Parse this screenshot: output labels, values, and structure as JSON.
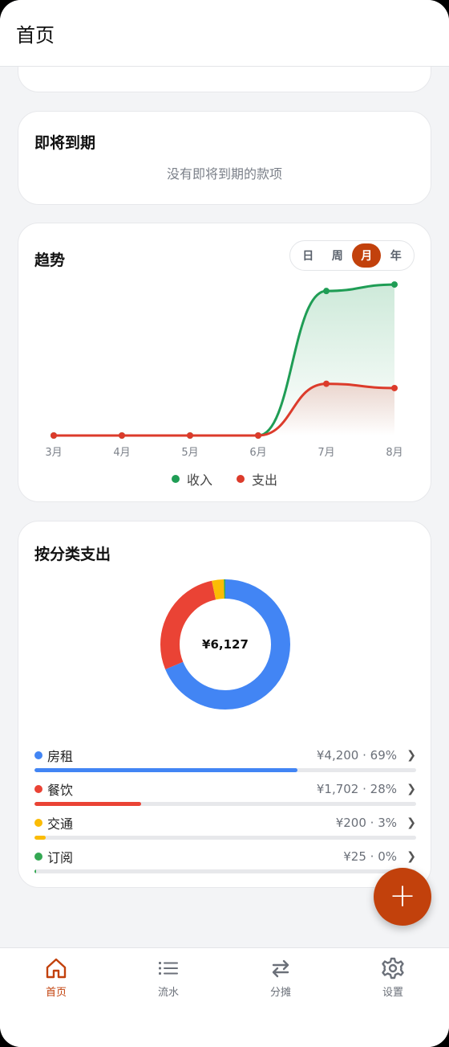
{
  "appbar": {
    "title": "首页"
  },
  "upcoming": {
    "title": "即将到期",
    "empty": "没有即将到期的款项"
  },
  "trend": {
    "title": "趋势",
    "periods": [
      "日",
      "周",
      "月",
      "年"
    ],
    "active_period": "月",
    "legend": {
      "income": "收入",
      "expense": "支出"
    },
    "colors": {
      "income": "#1f9d55",
      "expense": "#dc3b2b"
    }
  },
  "chart_data": {
    "type": "line",
    "x": [
      "3月",
      "4月",
      "5月",
      "6月",
      "7月",
      "8月"
    ],
    "series": [
      {
        "name": "收入",
        "values": [
          0,
          0,
          0,
          0,
          6700,
          7000
        ]
      },
      {
        "name": "支出",
        "values": [
          0,
          0,
          0,
          0,
          2400,
          2200
        ]
      }
    ],
    "ylim": [
      0,
      7600
    ],
    "grid": false,
    "legend": "bottom"
  },
  "category": {
    "title": "按分类支出",
    "total": "¥6,127",
    "items": [
      {
        "name": "房租",
        "amount": "¥4,200 · 69%",
        "share": 0.69,
        "color": "#4285f4"
      },
      {
        "name": "餐饮",
        "amount": "¥1,702 · 28%",
        "share": 0.28,
        "color": "#ea4335"
      },
      {
        "name": "交通",
        "amount": "¥200 · 3%",
        "share": 0.03,
        "color": "#fbbc05"
      },
      {
        "name": "订阅",
        "amount": "¥25 · 0%",
        "share": 0.004,
        "color": "#34a853"
      }
    ]
  },
  "fab": {
    "icon": "plus-icon",
    "label": "+"
  },
  "nav": [
    {
      "label": "首页",
      "icon": "home-icon",
      "active": true
    },
    {
      "label": "流水",
      "icon": "list-icon",
      "active": false
    },
    {
      "label": "分摊",
      "icon": "swap-icon",
      "active": false
    },
    {
      "label": "设置",
      "icon": "gear-icon",
      "active": false
    }
  ]
}
